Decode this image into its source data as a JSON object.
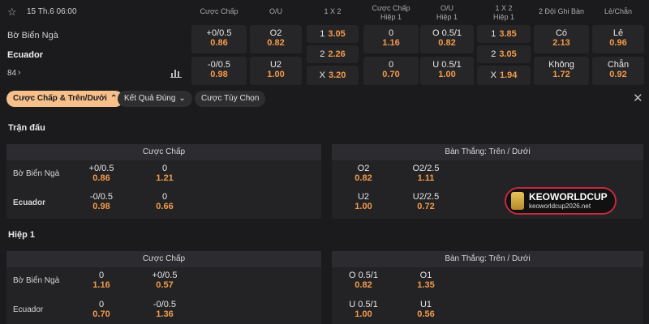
{
  "match": {
    "date": "15 Th.6 06:00",
    "home": "Bờ Biển Ngà",
    "away": "Ecuador",
    "more_count": "84"
  },
  "columns": {
    "handicap": "Cược Chấp",
    "ou": "O/U",
    "x12": "1 X 2",
    "handicap_h1_a": "Cược Chấp",
    "handicap_h1_b": "Hiệp 1",
    "ou_h1_a": "O/U",
    "ou_h1_b": "Hiệp 1",
    "x12_h1_a": "1 X 2",
    "x12_h1_b": "Hiệp 1",
    "btts": "2 Đội Ghi Bàn",
    "oddeven": "Lẻ/Chẵn"
  },
  "odds": {
    "hc_home": {
      "label": "+0/0.5",
      "odd": "0.86"
    },
    "hc_away": {
      "label": "-0/0.5",
      "odd": "0.98"
    },
    "ou_over": {
      "label": "O2",
      "odd": "0.82"
    },
    "ou_under": {
      "label": "U2",
      "odd": "1.00"
    },
    "x12_1": {
      "label": "1",
      "odd": "3.05"
    },
    "x12_2": {
      "label": "2",
      "odd": "2.26"
    },
    "x12_x": {
      "label": "X",
      "odd": "3.20"
    },
    "hch1_home": {
      "label": "0",
      "odd": "1.16"
    },
    "hch1_away": {
      "label": "0",
      "odd": "0.70"
    },
    "ouh1_over": {
      "label": "O 0.5/1",
      "odd": "0.82"
    },
    "ouh1_under": {
      "label": "U 0.5/1",
      "odd": "1.00"
    },
    "x12h1_1": {
      "label": "1",
      "odd": "3.85"
    },
    "x12h1_2": {
      "label": "2",
      "odd": "3.05"
    },
    "x12h1_x": {
      "label": "X",
      "odd": "1.94"
    },
    "btts_yes": {
      "label": "Có",
      "odd": "2.13"
    },
    "btts_no": {
      "label": "Không",
      "odd": "1.72"
    },
    "odd": {
      "label": "Lẻ",
      "odd": "0.96"
    },
    "even": {
      "label": "Chẵn",
      "odd": "0.92"
    }
  },
  "tabs": [
    "Cược Chấp & Trên/Dưới",
    "Kết Quả Đúng",
    "Cược Tùy Chọn"
  ],
  "sections": {
    "fulltime": {
      "title": "Trận đấu",
      "hc_title": "Cược Chấp",
      "ou_title": "Bàn Thắng: Trên / Dưới",
      "home": "Bờ Biển Ngà",
      "away": "Ecuador",
      "hc": [
        [
          {
            "label": "+0/0.5",
            "odd": "0.86"
          },
          {
            "label": "0",
            "odd": "1.21"
          }
        ],
        [
          {
            "label": "-0/0.5",
            "odd": "0.98"
          },
          {
            "label": "0",
            "odd": "0.66"
          }
        ]
      ],
      "ou": [
        [
          {
            "label": "O2",
            "odd": "0.82"
          },
          {
            "label": "O2/2.5",
            "odd": "1.11"
          }
        ],
        [
          {
            "label": "U2",
            "odd": "1.00"
          },
          {
            "label": "U2/2.5",
            "odd": "0.72"
          }
        ]
      ]
    },
    "half1": {
      "title": "Hiệp 1",
      "hc_title": "Cược Chấp",
      "ou_title": "Bàn Thắng: Trên / Dưới",
      "home": "Bờ Biển Ngà",
      "away": "Ecuador",
      "hc": [
        [
          {
            "label": "0",
            "odd": "1.16"
          },
          {
            "label": "+0/0.5",
            "odd": "0.57"
          }
        ],
        [
          {
            "label": "0",
            "odd": "0.70"
          },
          {
            "label": "-0/0.5",
            "odd": "1.36"
          }
        ]
      ],
      "ou": [
        [
          {
            "label": "O 0.5/1",
            "odd": "0.82"
          },
          {
            "label": "O1",
            "odd": "1.35"
          }
        ],
        [
          {
            "label": "U 0.5/1",
            "odd": "1.00"
          },
          {
            "label": "U1",
            "odd": "0.56"
          }
        ]
      ]
    }
  },
  "watermark": {
    "brand": "KEOWORLDCUP",
    "url": "keoworldcup2026.net"
  },
  "colors": {
    "odds": "#f29a4a",
    "accent_chip": "#f7c08a",
    "watermark_border": "#c6283e"
  }
}
